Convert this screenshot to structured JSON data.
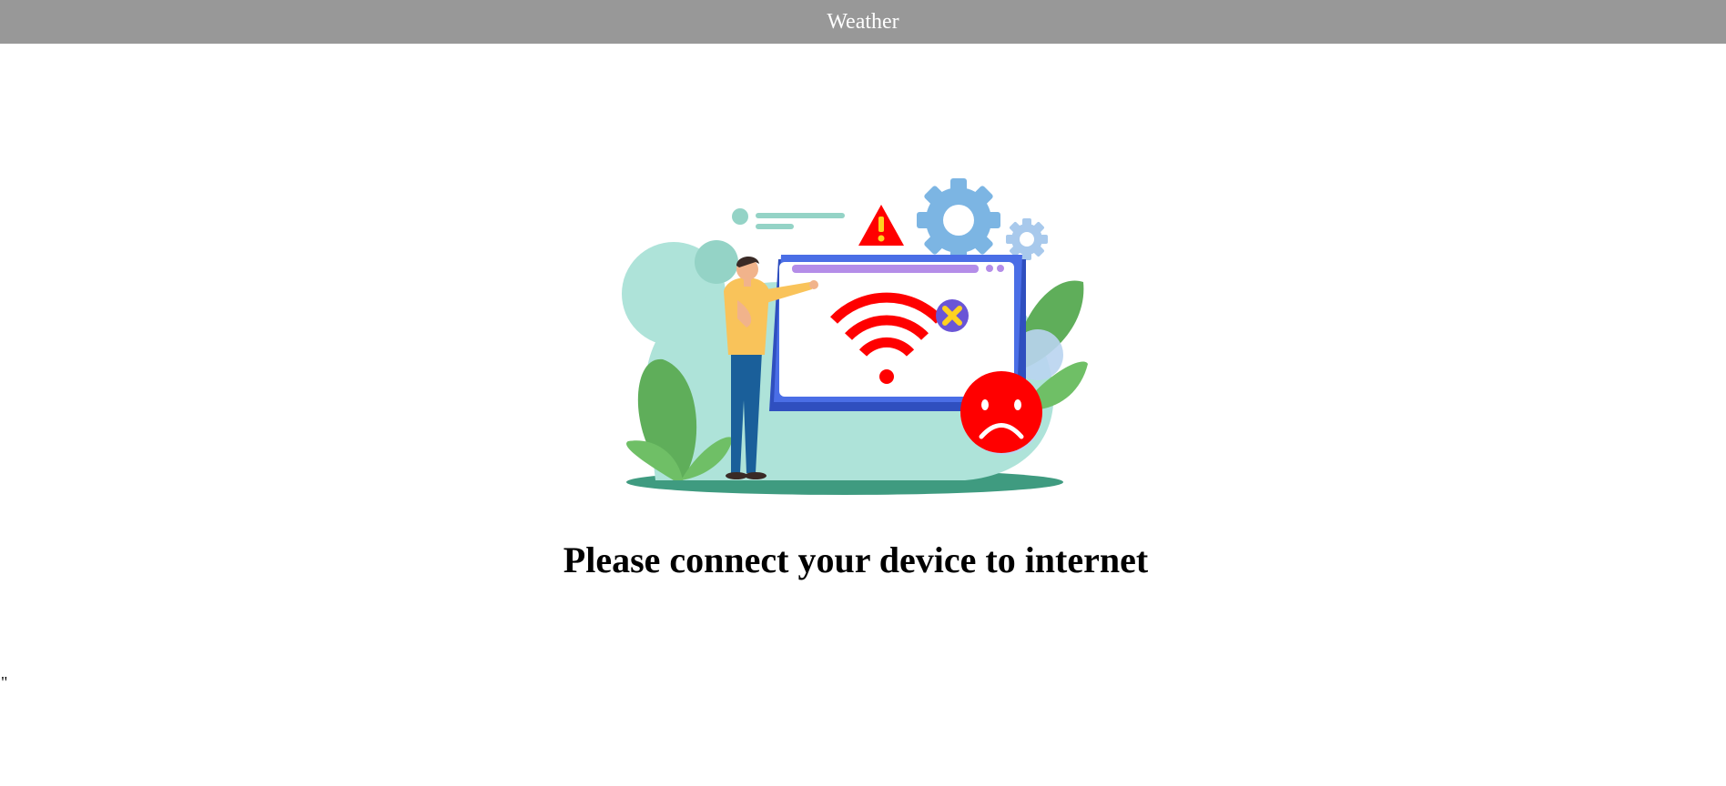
{
  "header": {
    "title": "Weather",
    "background": "#989898"
  },
  "main": {
    "message": "Please connect your device to internet",
    "illustration_icons": [
      "person-icon",
      "monitor-icon",
      "wifi-off-icon",
      "warning-icon",
      "gear-icon",
      "sad-face-icon",
      "leaf-icon"
    ]
  },
  "stray_text": "\"",
  "colors": {
    "alert_red": "#ff0000",
    "monitor_blue": "#2f4fbf",
    "leaf_green": "#5fae5a",
    "mint": "#aee3d9"
  }
}
